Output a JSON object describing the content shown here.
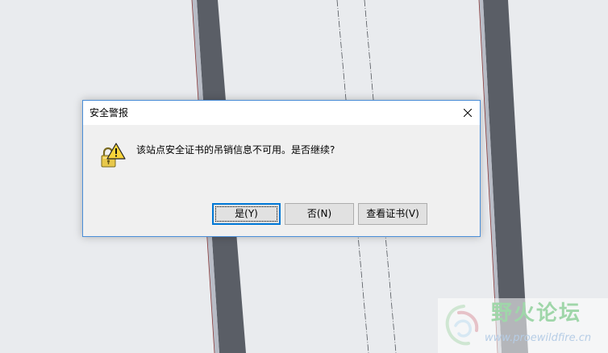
{
  "dialog": {
    "title": "安全警报",
    "message": "该站点安全证书的吊销信息不可用。是否继续?",
    "buttons": {
      "yes": "是(Y)",
      "no": "否(N)",
      "view_certificate": "查看证书(V)"
    },
    "icon": "lock-warning-icon"
  },
  "watermark": {
    "title": "野火论坛",
    "url": "www.proewildfire.cn"
  },
  "colors": {
    "background": "#e9ebee",
    "dialog_border": "#4a8ed8",
    "default_button_border": "#0078d7",
    "cad_part": "#5a5e66",
    "watermark_green": "#9fd6a9"
  }
}
